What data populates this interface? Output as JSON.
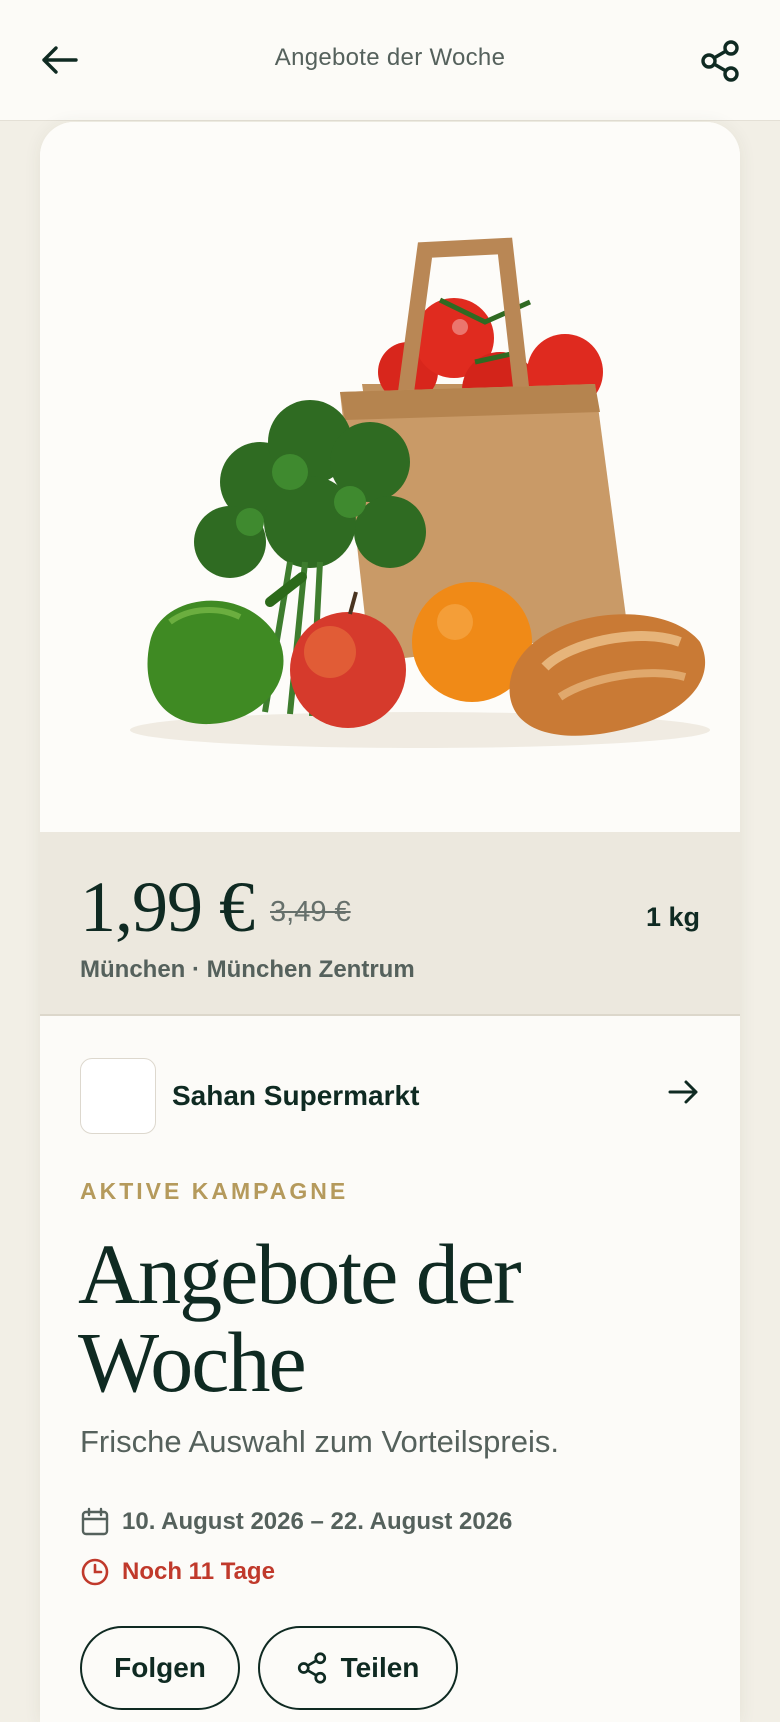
{
  "header": {
    "title": "Angebote der Woche",
    "back_icon": "arrow-left-icon",
    "share_icon": "share-icon"
  },
  "hero": {
    "image": "grocery-bag-vegetables-bread"
  },
  "price": {
    "current": "1,99 €",
    "old": "3,49 €",
    "unit": "1 kg",
    "location": "München · München Zentrum"
  },
  "seller": {
    "name": "Sahan Supermarkt",
    "arrow_icon": "arrow-right-icon"
  },
  "campaign": {
    "eyebrow": "AKTIVE KAMPAGNE",
    "title": "Angebote der Woche",
    "subtitle": "Frische Auswahl zum Vorteilspreis.",
    "dates": "10. August 2026 – 22. August 2026",
    "remaining": "Noch 11 Tage"
  },
  "actions": {
    "follow_label": "Folgen",
    "share_label": "Teilen"
  },
  "colors": {
    "accent": "#0f2a22",
    "eyebrow": "#b59a5c",
    "urgent": "#c0392b",
    "band": "#ece8de"
  }
}
